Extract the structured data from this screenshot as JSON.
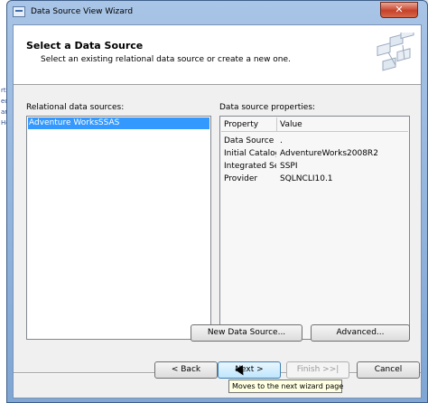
{
  "window": {
    "title": "Data Source View Wizard",
    "close_glyph": "✕"
  },
  "header": {
    "heading": "Select a Data Source",
    "subheading": "Select an existing relational data source or create a new one."
  },
  "background": {
    "left_texts": [
      "rtie",
      "ect",
      "ame",
      "Hel"
    ]
  },
  "relational": {
    "label": "Relational data sources:",
    "items": [
      "Adventure WorksSSAS"
    ],
    "selected_index": 0
  },
  "properties": {
    "label": "Data source properties:",
    "columns": [
      "Property",
      "Value"
    ],
    "rows": [
      {
        "property": "Data Source",
        "value": "."
      },
      {
        "property": "Initial Catalog",
        "value": "AdventureWorks2008R2"
      },
      {
        "property": "Integrated Se...",
        "value": "SSPI"
      },
      {
        "property": "Provider",
        "value": "SQLNCLI10.1"
      }
    ]
  },
  "buttons": {
    "new_data_source": "New Data Source...",
    "advanced": "Advanced...",
    "back": "< Back",
    "next": "Next >",
    "finish": "Finish >>|",
    "cancel": "Cancel"
  },
  "tooltip": "Moves to the next wizard page",
  "colors": {
    "selection": "#3399ff",
    "tooltip_bg": "#ffffe1",
    "close_button": "#c6412a"
  }
}
